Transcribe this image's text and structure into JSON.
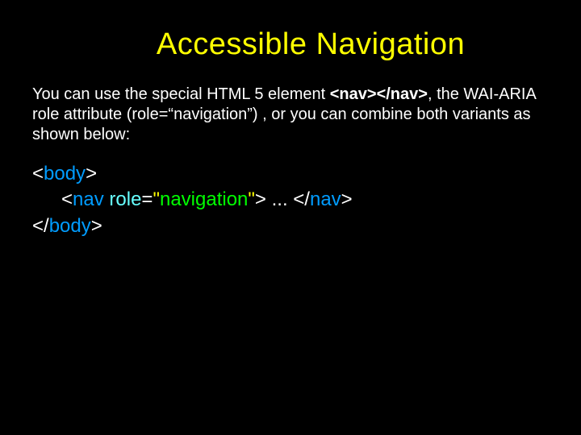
{
  "title": "Accessible Navigation",
  "paragraph": {
    "pre": "You can use the special HTML 5 element ",
    "navOpen": "<nav>",
    "navClose": "</nav>",
    "post": ", the WAI-ARIA role attribute (role=“navigation”) , or you can combine both variants as shown below:"
  },
  "code": {
    "lt": "<",
    "gt": ">",
    "slash": "/",
    "body": "body",
    "nav": "nav",
    "space": " ",
    "role": "role",
    "eq": "=",
    "quote": "\"",
    "val": "navigation",
    "dots": " ... "
  }
}
